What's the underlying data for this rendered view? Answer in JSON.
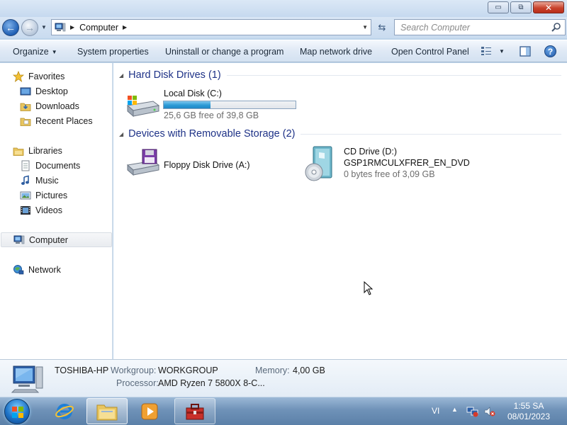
{
  "window": {
    "controls": {
      "minimize": "▭",
      "maximize": "⧉",
      "close": "✕"
    }
  },
  "address": {
    "crumb": "Computer",
    "search_placeholder": "Search Computer"
  },
  "toolbar": {
    "organize": "Organize",
    "system_properties": "System properties",
    "uninstall": "Uninstall or change a program",
    "map_drive": "Map network drive",
    "control_panel": "Open Control Panel",
    "help": "?"
  },
  "nav": {
    "favorites": "Favorites",
    "desktop": "Desktop",
    "downloads": "Downloads",
    "recent": "Recent Places",
    "libraries": "Libraries",
    "documents": "Documents",
    "music": "Music",
    "pictures": "Pictures",
    "videos": "Videos",
    "computer": "Computer",
    "network": "Network"
  },
  "groups": {
    "hdd_title": "Hard Disk Drives (1)",
    "removable_title": "Devices with Removable Storage (2)"
  },
  "drives": {
    "local_disk": {
      "name": "Local Disk (C:)",
      "space": "25,6 GB free of 39,8 GB",
      "used_fraction": 0.357
    },
    "floppy": {
      "name": "Floppy Disk Drive (A:)"
    },
    "cd": {
      "name": "CD Drive (D:)",
      "volume": "GSP1RMCULXFRER_EN_DVD",
      "space": "0 bytes free of 3,09 GB"
    }
  },
  "details": {
    "computer_name": "TOSHIBA-HP",
    "workgroup_label": "Workgroup:",
    "workgroup": "WORKGROUP",
    "memory_label": "Memory:",
    "memory": "4,00 GB",
    "processor_label": "Processor:",
    "processor": "AMD Ryzen 7 5800X 8-C..."
  },
  "taskbar": {
    "language": "VI",
    "time": "1:55 SA",
    "date": "08/01/2023"
  },
  "colors": {
    "group_title": "#1e3287",
    "capacity_bar": "#2c9ad6",
    "taskbar": "#6f92b8"
  }
}
